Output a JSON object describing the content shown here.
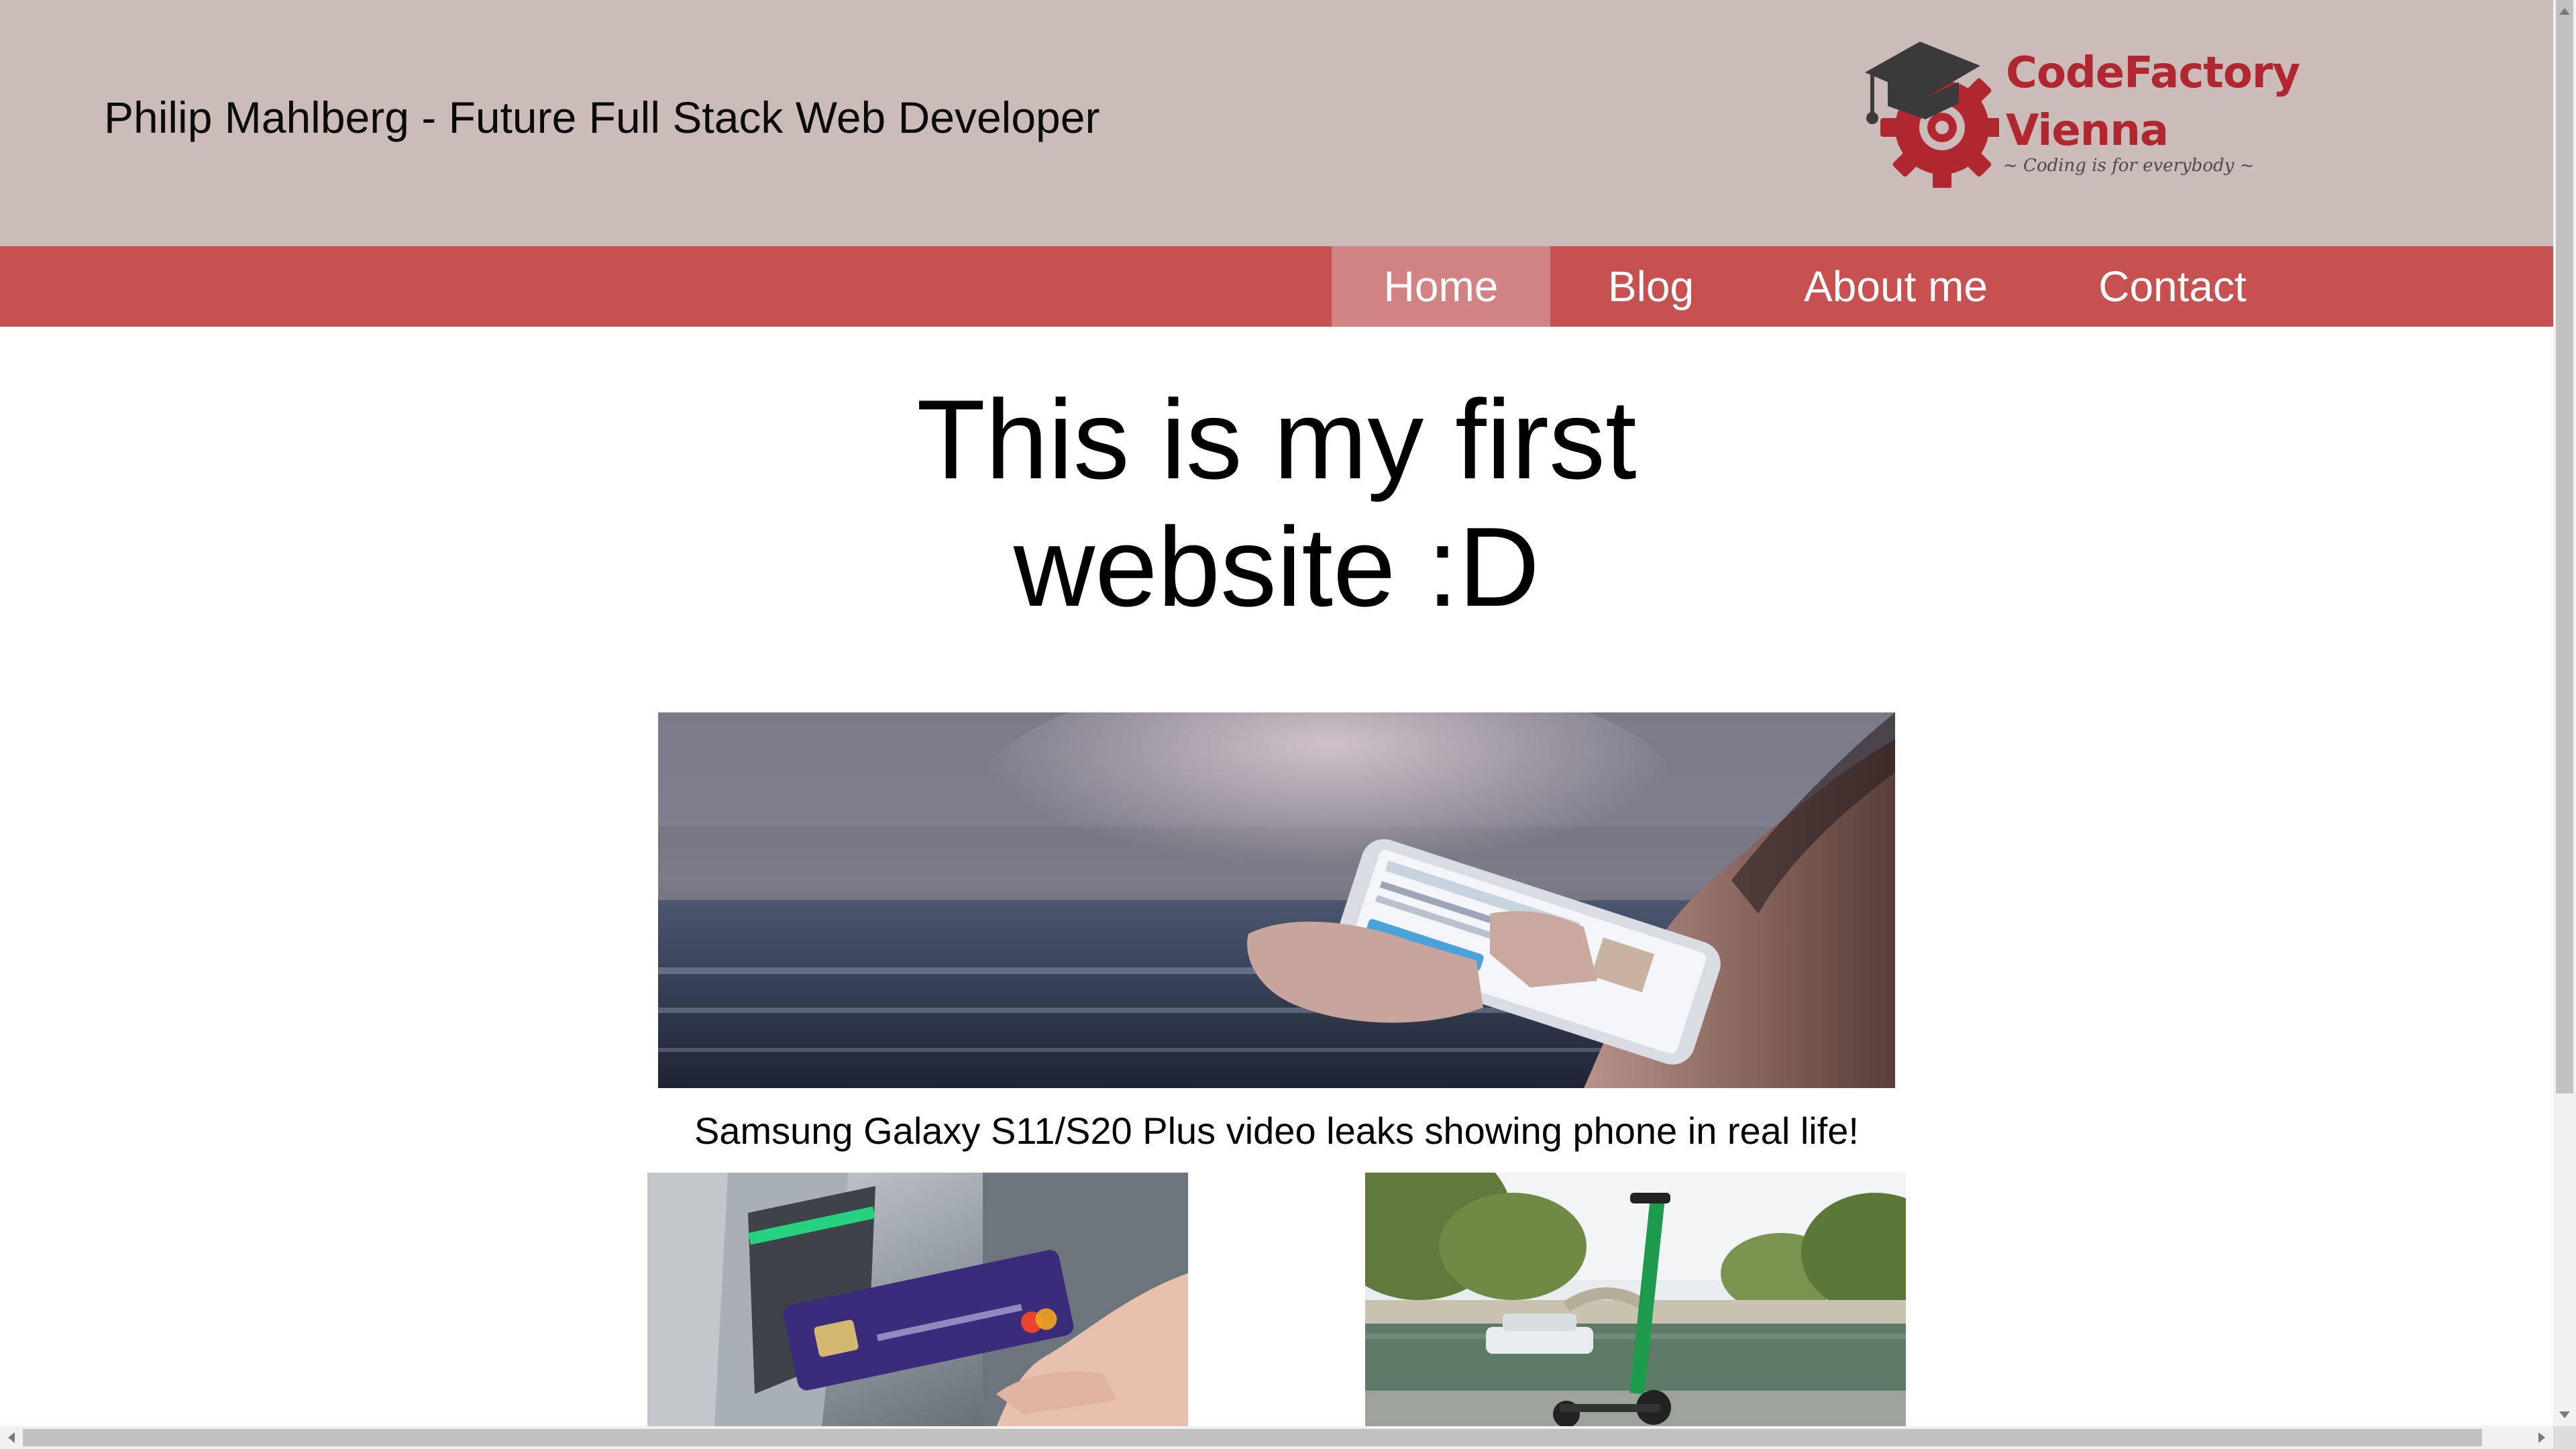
{
  "header": {
    "title": "Philip Mahlberg - Future Full Stack Web Developer",
    "logo": {
      "line1": "CodeFactory",
      "line2": "Vienna",
      "tagline": "~ Coding is for everybody ~",
      "icon": "graduation-cap-gear-icon",
      "brand_color": "#b0272f"
    },
    "background": "#cbbcb9"
  },
  "nav": {
    "background": "#c75151",
    "active_background": "#d18383",
    "items": [
      {
        "label": "Home",
        "active": true
      },
      {
        "label": "Blog",
        "active": false
      },
      {
        "label": "About me",
        "active": false
      },
      {
        "label": "Contact",
        "active": false
      }
    ]
  },
  "main": {
    "heading_line1": "This is my first",
    "heading_line2": "website :D",
    "hero": {
      "image": "hands-holding-smartphone-street-photo",
      "caption": "Samsung Galaxy S11/S20 Plus video leaks showing phone in real life!"
    },
    "cards": [
      {
        "image": "card-inserted-into-atm-photo"
      },
      {
        "image": "electric-scooter-by-river-photo"
      }
    ]
  }
}
